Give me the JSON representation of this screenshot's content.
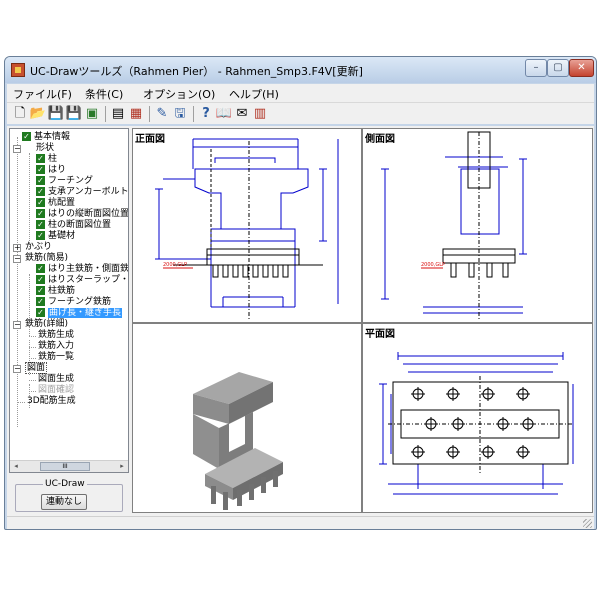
{
  "window": {
    "title": "UC-Drawツールズ（Rahmen Pier） - Rahmen_Smp3.F4V[更新]",
    "controls": {
      "minimize": "–",
      "maximize": "▢",
      "close": "✕"
    }
  },
  "menu": [
    {
      "label": "ファイル(F)"
    },
    {
      "label": "条件(C)"
    },
    {
      "label": "オプション(O)"
    },
    {
      "label": "ヘルプ(H)"
    }
  ],
  "toolbar": [
    {
      "icon": "new-document-icon",
      "glyph": "🗋"
    },
    {
      "icon": "open-folder-icon",
      "glyph": "📂"
    },
    {
      "icon": "save-icon",
      "glyph": "💾"
    },
    {
      "icon": "save-as-icon",
      "glyph": "💾"
    },
    {
      "icon": "image-icon",
      "glyph": "▣"
    },
    {
      "icon": "display-icon",
      "glyph": "▤"
    },
    {
      "icon": "table-icon",
      "glyph": "▦"
    },
    {
      "icon": "edit-icon",
      "glyph": "✎"
    },
    {
      "icon": "monitor-icon",
      "glyph": "🖫"
    },
    {
      "icon": "help-icon",
      "glyph": "?"
    },
    {
      "icon": "book-icon",
      "glyph": "📖"
    },
    {
      "icon": "mail-icon",
      "glyph": "✉"
    },
    {
      "icon": "calculator-icon",
      "glyph": "▥"
    }
  ],
  "tree": {
    "items": [
      {
        "label": "基本情報",
        "checked": true
      },
      {
        "label": "形状",
        "checked": false
      },
      {
        "label": "柱",
        "checked": true
      },
      {
        "label": "はり",
        "checked": true
      },
      {
        "label": "フーチング",
        "checked": true
      },
      {
        "label": "支承アンカーボルト",
        "checked": true
      },
      {
        "label": "杭配置",
        "checked": true
      },
      {
        "label": "はりの縦断面図位置",
        "checked": true
      },
      {
        "label": "柱の断面図位置",
        "checked": true
      },
      {
        "label": "基礎材",
        "checked": true
      },
      {
        "label": "かぶり",
        "checked": false
      },
      {
        "label": "鉄筋(簡易)",
        "checked": false
      },
      {
        "label": "はり主鉄筋・側面鉄",
        "checked": true
      },
      {
        "label": "はりスターラップ・(",
        "checked": true
      },
      {
        "label": "柱鉄筋",
        "checked": true
      },
      {
        "label": "フーチング鉄筋",
        "checked": true
      },
      {
        "label": "曲げ長・継ぎ手長",
        "checked": true,
        "selected": true
      },
      {
        "label": "鉄筋(詳細)",
        "checked": false
      },
      {
        "label": "鉄筋生成",
        "checked": false
      },
      {
        "label": "鉄筋入力",
        "checked": false
      },
      {
        "label": "鉄筋一覧",
        "checked": false
      },
      {
        "label": "図面",
        "checked": false
      },
      {
        "label": "図面生成",
        "checked": false
      },
      {
        "label": "図面確認",
        "checked": false,
        "disabled": true
      },
      {
        "label": "3D配筋生成",
        "checked": false
      }
    ],
    "scroll_left": "◂",
    "scroll_thumb": "III",
    "scroll_right": "▸"
  },
  "uc_draw": {
    "group_label": "UC-Draw",
    "button_label": "連動なし"
  },
  "panes": {
    "front": {
      "title": "正面図",
      "label": "2000,GLP"
    },
    "side": {
      "title": "側面図",
      "label": "2000,GLP"
    },
    "plan": {
      "title": "平面図"
    },
    "model3d": {
      "title": ""
    }
  },
  "colors": {
    "accent": "#0000cc",
    "selection": "#3399ff",
    "red": "#d81010",
    "model": "#8c8c8c"
  }
}
